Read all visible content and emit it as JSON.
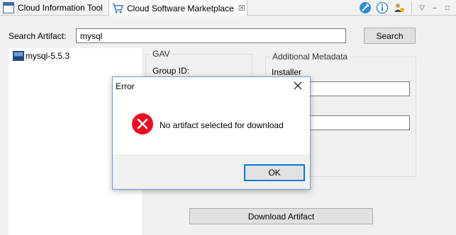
{
  "tabs": [
    {
      "label": "Cloud Information Tool",
      "icon": "window-icon"
    },
    {
      "label": "Cloud Software Marketplace",
      "icon": "cart-icon",
      "close": "☒"
    }
  ],
  "toolbar": {
    "icons": [
      "tools-icon",
      "info-icon",
      "users-icon"
    ],
    "mini": [
      "▽",
      "–",
      "□"
    ]
  },
  "search": {
    "label": "Search Artifact:",
    "value": "mysql",
    "button": "Search"
  },
  "tree": {
    "items": [
      {
        "label": "mysql-5.5.3",
        "icon": "package-icon"
      }
    ]
  },
  "gav": {
    "title": "GAV",
    "group_id_label": "Group ID:"
  },
  "metadata": {
    "title": "Additional Metadata",
    "installer_label": "Installer",
    "description_partial": "ction"
  },
  "download_button": "Download Artifact",
  "dialog": {
    "title": "Error",
    "message": "No artifact selected for download",
    "ok": "OK",
    "error_color": "#e81123"
  }
}
